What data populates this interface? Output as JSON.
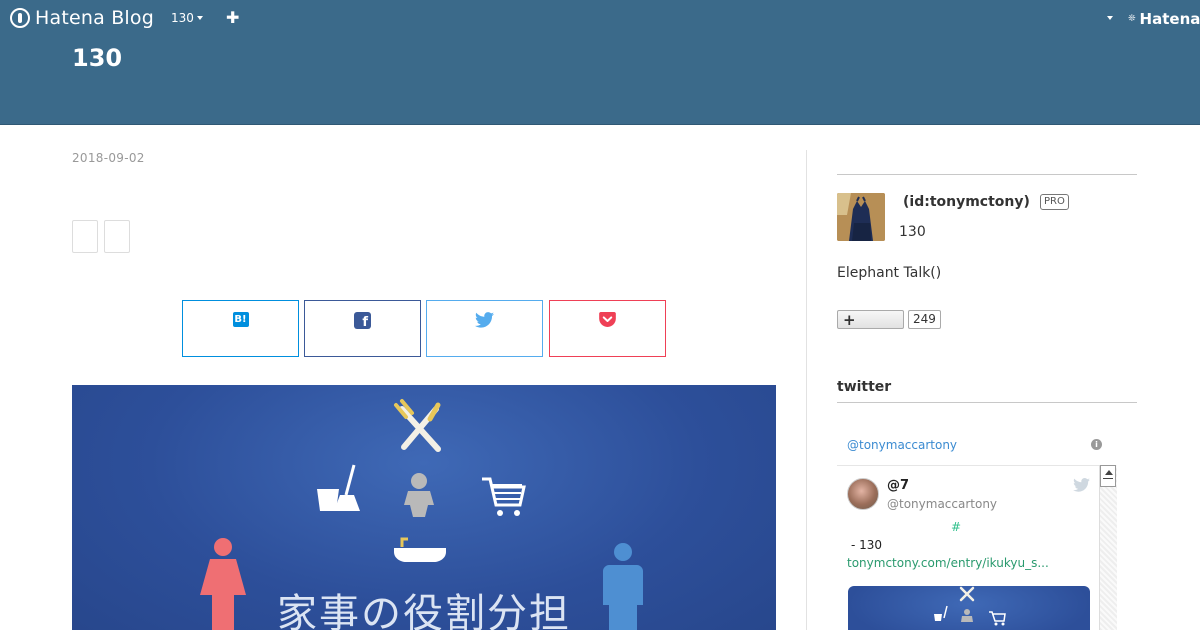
{
  "topbar": {
    "logo_text": "Hatena Blog",
    "blog_selector": "130",
    "add_icon": "plus-icon",
    "hatena_logo_text": "Hatena",
    "colors": {
      "bar": "#3b6a8a",
      "text": "#ffffff"
    }
  },
  "header": {
    "blog_title": "130"
  },
  "entry": {
    "date": "2018-09-02",
    "share_buttons": [
      {
        "service": "Hatena Bookmark",
        "icon": "hatena-bookmark-icon",
        "glyph": "B!",
        "color": "#008fde"
      },
      {
        "service": "Facebook",
        "icon": "facebook-icon",
        "glyph": "f",
        "color": "#3b5998"
      },
      {
        "service": "Twitter",
        "icon": "twitter-icon",
        "color": "#55acee"
      },
      {
        "service": "Pocket",
        "icon": "pocket-icon",
        "color": "#ef4056"
      }
    ],
    "hero": {
      "title": "家事の役割分担",
      "icons": [
        "fork-knife-icon",
        "bucket-broom-icon",
        "baby-icon",
        "shopping-cart-icon",
        "bathtub-icon",
        "woman-icon",
        "man-icon"
      ],
      "background": "#2d4f9a"
    }
  },
  "sidebar": {
    "profile": {
      "id": "(id:tonymctony)",
      "pro_badge": "PRO",
      "name": "130",
      "description": "Elephant Talk()",
      "follow_label": "+",
      "follower_count": "249"
    },
    "twitter_module": {
      "title": "twitter",
      "handle": "@tonymaccartony",
      "tweet": {
        "display_name": "@7",
        "username": "@tonymaccartony",
        "hashtag": "#",
        "text": "- 130",
        "link": "tonymctony.com/entry/ikukyu_s..."
      }
    }
  }
}
